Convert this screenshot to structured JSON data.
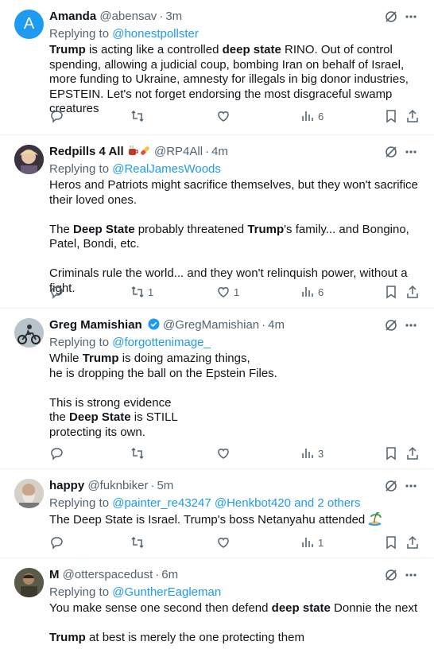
{
  "tweets": [
    {
      "name": "Amanda",
      "handle": "@abensav",
      "time": "3m",
      "replying_prefix": "Replying to",
      "replying_to": "@honestpollster",
      "avatar_letter": "A",
      "paragraphs": [
        [
          {
            "t": "Trump",
            "b": true
          },
          {
            "t": " is acting like a controlled "
          },
          {
            "t": "deep state",
            "b": true
          },
          {
            "t": " RINO. Out of control spending, allowing a judicial coup, bombing Iran on behalf of Israel, more funding to Ukraine, amnesty for illegals in big donor industries, EPSTEIN. Let's not forget endorsing the most disgraceful swamp creatures"
          }
        ]
      ],
      "replies": "",
      "retweets": "",
      "likes": "",
      "views": "6"
    },
    {
      "name": "Redpills 4 All",
      "handle": "@RP4All",
      "time": "4m",
      "replying_prefix": "Replying to",
      "replying_to": "@RealJamesWoods",
      "paragraphs": [
        [
          {
            "t": "Heros and Patriots might sacrifice themselves, but they won't sacrifice their loved ones."
          }
        ],
        [
          {
            "t": "The "
          },
          {
            "t": "Deep State",
            "b": true
          },
          {
            "t": " probably threatened "
          },
          {
            "t": "Trump",
            "b": true
          },
          {
            "t": "'s family... and Bongino, Patel, Bondi, etc."
          }
        ],
        [
          {
            "t": "Criminals rule the world... and they won't relinquish power, without a fight."
          }
        ]
      ],
      "replies": "",
      "retweets": "1",
      "likes": "1",
      "views": "6"
    },
    {
      "name": "Greg Mamishian",
      "handle": "@GregMamishian",
      "time": "4m",
      "replying_prefix": "Replying to",
      "replying_to": "@forgottenimage_",
      "paragraphs": [
        [
          {
            "t": "While "
          },
          {
            "t": "Trump",
            "b": true
          },
          {
            "t": " is doing amazing things,"
          },
          {
            "br": true
          },
          {
            "t": "he is dropping the ball on the Epstein Files."
          }
        ],
        [
          {
            "t": "This is strong evidence"
          },
          {
            "br": true
          },
          {
            "t": "the "
          },
          {
            "t": "Deep State",
            "b": true
          },
          {
            "t": " is STILL"
          },
          {
            "br": true
          },
          {
            "t": "protecting its own."
          }
        ]
      ],
      "replies": "",
      "retweets": "",
      "likes": "",
      "views": "3"
    },
    {
      "name": "happy",
      "handle": "@fuknbiker",
      "time": "5m",
      "replying_prefix": "Replying to",
      "replying_to": "@painter_re43247 @Henkbot420 and 2 others",
      "paragraphs": [
        [
          {
            "t": "The Deep State is Israel. Trump's boss Netanyahu attended "
          }
        ]
      ],
      "replies": "",
      "retweets": "",
      "likes": "",
      "views": "1"
    },
    {
      "name": "M",
      "handle": "@otterspacedust",
      "time": "6m",
      "replying_prefix": "Replying to",
      "replying_to": "@GuntherEagleman",
      "paragraphs": [
        [
          {
            "t": "You make sense one second then defend "
          },
          {
            "t": "deep state",
            "b": true
          },
          {
            "t": " Donnie the next"
          }
        ],
        [
          {
            "t": "Trump",
            "b": true
          },
          {
            "t": " at best is merely the one protecting them"
          }
        ]
      ]
    }
  ],
  "colors": {
    "link": "#1d9bf0",
    "muted": "#536471",
    "text": "#0f1419",
    "avatar_a": "#1d9bf0",
    "verified": "#1d9bf0"
  }
}
